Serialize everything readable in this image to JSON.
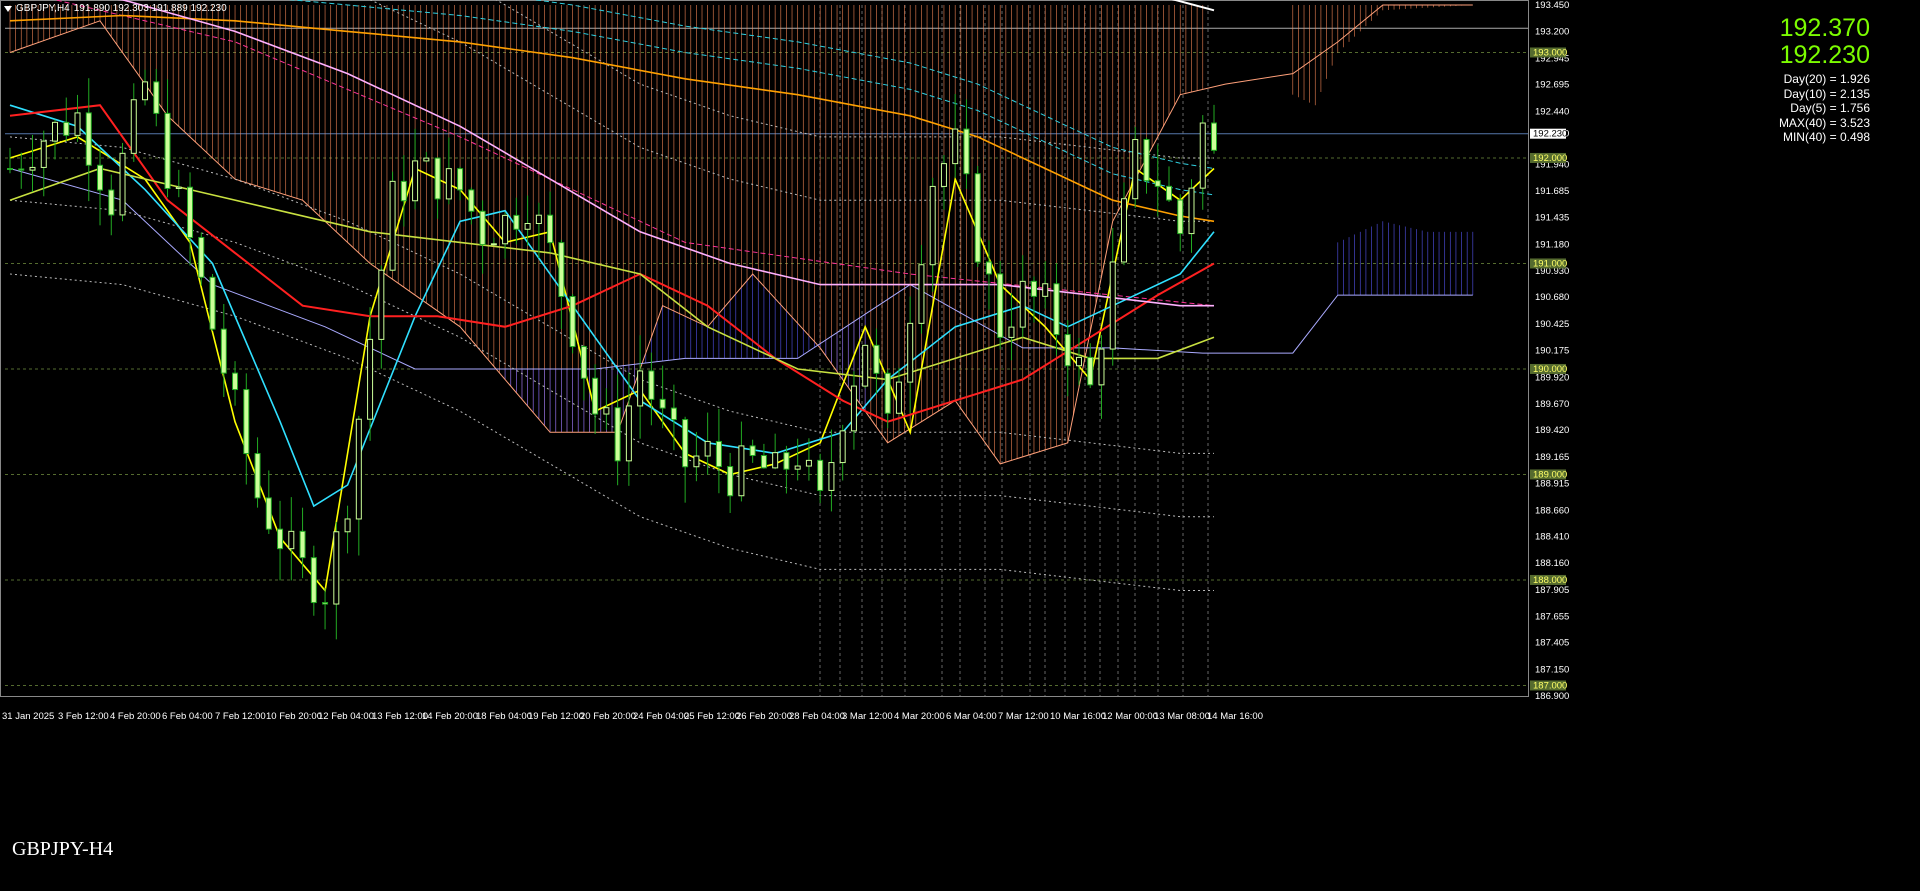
{
  "header": {
    "symbol": "GBPJPY,H4",
    "ohlc": "191.890 192.303 191.889 192.230"
  },
  "bid_price": "192.370",
  "ask_price": "192.230",
  "stats": [
    "Day(20) = 1.926",
    "Day(10) = 2.135",
    "Day(5) = 1.756",
    "MAX(40) = 3.523",
    "MIN(40) = 0.498"
  ],
  "watermark": "GBPJPY-H4",
  "colors": {
    "bull": "#ccff99",
    "bear": "#22aa22",
    "cloud_bear": "#ff8c5a",
    "cloud_bull": "#5a5aff",
    "ma_red": "#ff2020",
    "ma_cyan": "#30e0ff",
    "ma_yellow": "#ffff00",
    "ma_orange": "#ffa000",
    "ma_pink": "#ffb0ff",
    "ma_olive": "#c8e040",
    "price_label": "#7CFC00"
  },
  "chart_data": {
    "type": "candlestick",
    "symbol": "GBPJPY",
    "timeframe": "H4",
    "ylim": [
      186.9,
      193.45
    ],
    "y_ticks": [
      "193.450",
      "193.200",
      "192.945",
      "192.695",
      "192.440",
      "192.230",
      "191.940",
      "191.685",
      "191.435",
      "191.180",
      "190.930",
      "190.680",
      "190.425",
      "190.175",
      "189.920",
      "189.670",
      "189.420",
      "189.165",
      "188.915",
      "188.660",
      "188.410",
      "188.160",
      "187.905",
      "187.655",
      "187.405",
      "187.150",
      "186.900"
    ],
    "round_levels": [
      "193.000",
      "192.000",
      "191.000",
      "190.000",
      "189.000",
      "188.000",
      "187.000"
    ],
    "current_price": "192.230",
    "x_labels": [
      "31 Jan 2025",
      "3 Feb 12:00",
      "4 Feb 20:00",
      "6 Feb 04:00",
      "7 Feb 12:00",
      "10 Feb 20:00",
      "12 Feb 04:00",
      "13 Feb 12:00",
      "14 Feb 20:00",
      "18 Feb 04:00",
      "19 Feb 12:00",
      "20 Feb 20:00",
      "24 Feb 04:00",
      "25 Feb 12:00",
      "26 Feb 20:00",
      "28 Feb 04:00",
      "3 Mar 12:00",
      "4 Mar 20:00",
      "6 Mar 04:00",
      "7 Mar 12:00",
      "10 Mar 16:00",
      "12 Mar 00:00",
      "13 Mar 08:00",
      "14 Mar 16:00"
    ],
    "close_path": [
      [
        0,
        191.9
      ],
      [
        3,
        192.2
      ],
      [
        6,
        192.4
      ],
      [
        9,
        191.6
      ],
      [
        12,
        192.7
      ],
      [
        14,
        191.9
      ],
      [
        16,
        191.2
      ],
      [
        18,
        190.4
      ],
      [
        20,
        189.6
      ],
      [
        22,
        188.8
      ],
      [
        24,
        188.4
      ],
      [
        26,
        188.1
      ],
      [
        28,
        187.9
      ],
      [
        30,
        188.8
      ],
      [
        32,
        190.3
      ],
      [
        34,
        191.6
      ],
      [
        36,
        191.9
      ],
      [
        38,
        191.8
      ],
      [
        40,
        191.7
      ],
      [
        42,
        191.3
      ],
      [
        44,
        191.4
      ],
      [
        46,
        191.6
      ],
      [
        48,
        191.1
      ],
      [
        50,
        190.4
      ],
      [
        52,
        189.6
      ],
      [
        54,
        189.3
      ],
      [
        56,
        190.0
      ],
      [
        58,
        189.5
      ],
      [
        60,
        189.1
      ],
      [
        62,
        189.2
      ],
      [
        64,
        189.0
      ],
      [
        66,
        189.1
      ],
      [
        68,
        189.0
      ],
      [
        70,
        189.2
      ],
      [
        72,
        188.7
      ],
      [
        74,
        189.6
      ],
      [
        76,
        190.3
      ],
      [
        78,
        189.4
      ],
      [
        80,
        190.6
      ],
      [
        82,
        191.8
      ],
      [
        84,
        192.1
      ],
      [
        86,
        191.2
      ],
      [
        88,
        190.4
      ],
      [
        90,
        190.7
      ],
      [
        92,
        190.6
      ],
      [
        94,
        190.2
      ],
      [
        96,
        189.8
      ],
      [
        98,
        190.9
      ],
      [
        100,
        192.0
      ],
      [
        102,
        191.8
      ],
      [
        104,
        191.3
      ],
      [
        106,
        192.3
      ],
      [
        107,
        192.0
      ]
    ],
    "series": [
      {
        "color": "#ffff00",
        "values": [
          [
            0,
            192.0
          ],
          [
            6,
            192.2
          ],
          [
            12,
            191.8
          ],
          [
            16,
            191.2
          ],
          [
            20,
            189.5
          ],
          [
            24,
            188.4
          ],
          [
            28,
            187.9
          ],
          [
            32,
            190.5
          ],
          [
            36,
            191.9
          ],
          [
            40,
            191.7
          ],
          [
            44,
            191.2
          ],
          [
            48,
            191.3
          ],
          [
            52,
            189.6
          ],
          [
            56,
            189.8
          ],
          [
            60,
            189.2
          ],
          [
            64,
            189.0
          ],
          [
            68,
            189.1
          ],
          [
            72,
            189.3
          ],
          [
            76,
            190.4
          ],
          [
            80,
            189.4
          ],
          [
            84,
            191.8
          ],
          [
            88,
            190.8
          ],
          [
            92,
            190.4
          ],
          [
            96,
            189.9
          ],
          [
            100,
            191.9
          ],
          [
            104,
            191.6
          ],
          [
            107,
            191.9
          ]
        ]
      },
      {
        "color": "#30e0ff",
        "values": [
          [
            0,
            192.5
          ],
          [
            6,
            192.3
          ],
          [
            12,
            191.7
          ],
          [
            18,
            191.0
          ],
          [
            24,
            189.5
          ],
          [
            27,
            188.7
          ],
          [
            30,
            188.9
          ],
          [
            36,
            190.5
          ],
          [
            40,
            191.4
          ],
          [
            44,
            191.5
          ],
          [
            50,
            190.6
          ],
          [
            56,
            189.7
          ],
          [
            62,
            189.3
          ],
          [
            68,
            189.2
          ],
          [
            74,
            189.4
          ],
          [
            78,
            189.9
          ],
          [
            84,
            190.4
          ],
          [
            90,
            190.6
          ],
          [
            94,
            190.4
          ],
          [
            98,
            190.6
          ],
          [
            104,
            190.9
          ],
          [
            107,
            191.3
          ]
        ]
      },
      {
        "color": "#ff2020",
        "values": [
          [
            0,
            192.4
          ],
          [
            8,
            192.5
          ],
          [
            14,
            191.6
          ],
          [
            20,
            191.1
          ],
          [
            26,
            190.6
          ],
          [
            32,
            190.5
          ],
          [
            38,
            190.5
          ],
          [
            44,
            190.4
          ],
          [
            50,
            190.6
          ],
          [
            56,
            190.9
          ],
          [
            62,
            190.6
          ],
          [
            68,
            190.1
          ],
          [
            74,
            189.7
          ],
          [
            78,
            189.5
          ],
          [
            84,
            189.7
          ],
          [
            90,
            189.9
          ],
          [
            96,
            190.3
          ],
          [
            102,
            190.7
          ],
          [
            107,
            191.0
          ]
        ]
      },
      {
        "color": "#c8e040",
        "values": [
          [
            0,
            191.6
          ],
          [
            8,
            191.9
          ],
          [
            16,
            191.7
          ],
          [
            24,
            191.5
          ],
          [
            32,
            191.3
          ],
          [
            40,
            191.2
          ],
          [
            48,
            191.1
          ],
          [
            56,
            190.9
          ],
          [
            62,
            190.4
          ],
          [
            70,
            190.0
          ],
          [
            78,
            189.9
          ],
          [
            84,
            190.1
          ],
          [
            90,
            190.3
          ],
          [
            96,
            190.1
          ],
          [
            102,
            190.1
          ],
          [
            107,
            190.3
          ]
        ]
      },
      {
        "color": "#ffa000",
        "values": [
          [
            0,
            193.3
          ],
          [
            10,
            193.35
          ],
          [
            20,
            193.3
          ],
          [
            30,
            193.2
          ],
          [
            40,
            193.1
          ],
          [
            50,
            192.95
          ],
          [
            60,
            192.75
          ],
          [
            70,
            192.6
          ],
          [
            80,
            192.4
          ],
          [
            86,
            192.2
          ],
          [
            92,
            191.9
          ],
          [
            98,
            191.6
          ],
          [
            104,
            191.45
          ],
          [
            107,
            191.4
          ]
        ]
      },
      {
        "color": "#ffb0ff",
        "values": [
          [
            0,
            193.6
          ],
          [
            10,
            193.5
          ],
          [
            20,
            193.2
          ],
          [
            30,
            192.8
          ],
          [
            40,
            192.3
          ],
          [
            48,
            191.8
          ],
          [
            56,
            191.3
          ],
          [
            64,
            191.0
          ],
          [
            72,
            190.8
          ],
          [
            80,
            190.8
          ],
          [
            88,
            190.8
          ],
          [
            96,
            190.7
          ],
          [
            104,
            190.6
          ],
          [
            107,
            190.6
          ]
        ]
      }
    ]
  }
}
